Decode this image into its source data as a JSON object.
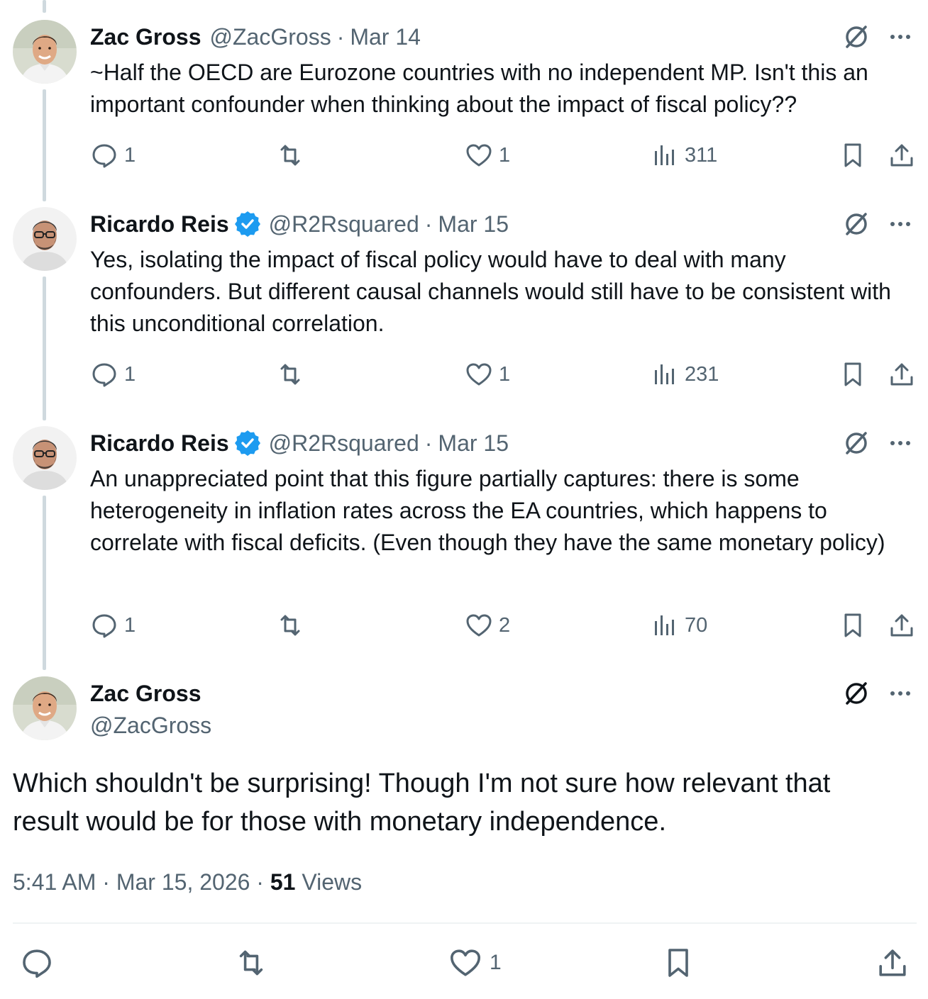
{
  "replies": [
    {
      "name": "Zac Gross",
      "verified": false,
      "handle": "@ZacGross",
      "sep": "·",
      "date": "Mar 14",
      "text": "~Half the OECD are Eurozone countries with no independent MP. Isn't this an important confounder when thinking about the impact of fiscal policy??",
      "reply_count": "1",
      "like_count": "1",
      "view_count": "311"
    },
    {
      "name": "Ricardo Reis",
      "verified": true,
      "handle": "@R2Rsquared",
      "sep": "·",
      "date": "Mar 15",
      "text": "Yes, isolating the impact of fiscal policy would have to deal with many confounders. But different causal channels would still have to be consistent with this unconditional correlation.",
      "reply_count": "1",
      "like_count": "1",
      "view_count": "231"
    },
    {
      "name": "Ricardo Reis",
      "verified": true,
      "handle": "@R2Rsquared",
      "sep": "·",
      "date": "Mar 15",
      "text": "An unappreciated point that this figure partially captures: there is some heterogeneity in inflation rates across the EA countries, which happens to correlate with fiscal deficits. (Even though they have the same monetary policy)",
      "reply_count": "1",
      "like_count": "2",
      "view_count": "70"
    }
  ],
  "main": {
    "name": "Zac Gross",
    "handle": "@ZacGross",
    "text": "Which shouldn't be surprising! Though I'm not sure how relevant that result would be for those with monetary independence.",
    "time": "5:41 AM",
    "sep1": "·",
    "date": "Mar 15, 2026",
    "sep2": "·",
    "views_count": "51",
    "views_label": "Views",
    "like_count": "1"
  },
  "icons": {
    "reply": "speech-bubble-icon",
    "retweet": "retweet-arrows-icon",
    "like": "heart-icon",
    "views": "bar-chart-icon",
    "bookmark": "bookmark-icon",
    "share": "share-upload-icon",
    "grok": "grok-slash-circle-icon",
    "more": "ellipsis-icon",
    "verified": "verified-badge-icon"
  },
  "colors": {
    "text_primary": "#0f1419",
    "text_secondary": "#536471",
    "verified_blue": "#1d9bf0",
    "thread_line": "#cfd9de",
    "divider": "#eff3f4"
  }
}
